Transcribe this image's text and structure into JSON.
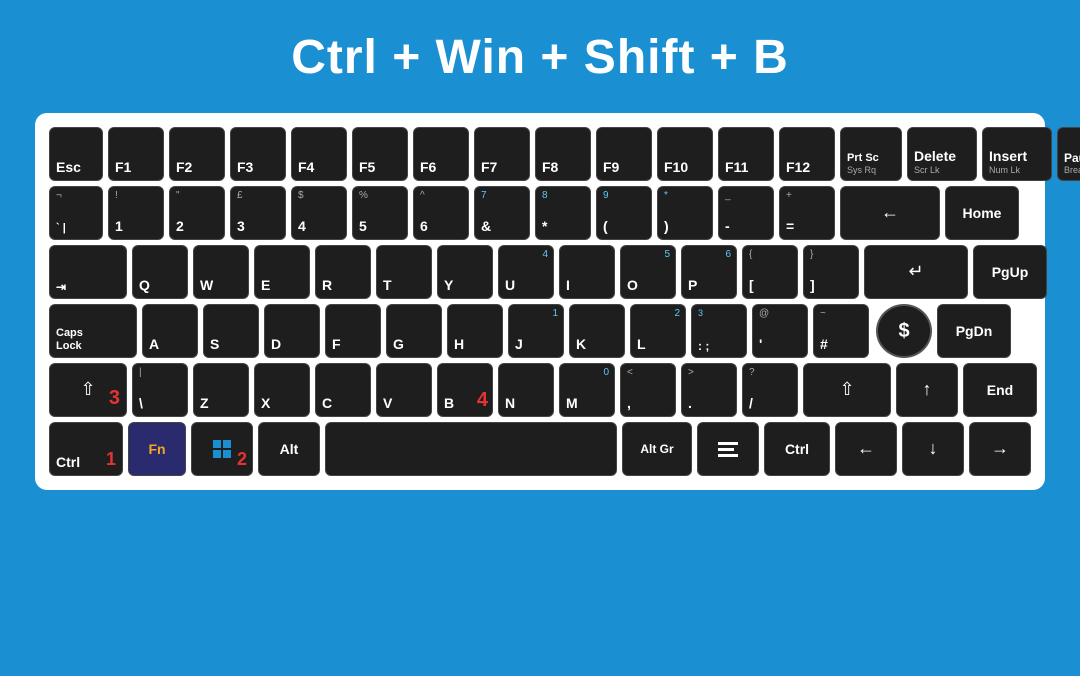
{
  "title": "Ctrl + Win + Shift + B",
  "keyboard": {
    "row1": {
      "keys": [
        "Esc",
        "F1",
        "F2",
        "F3",
        "F4",
        "F5",
        "F6",
        "F7",
        "F8",
        "F9",
        "F10",
        "F11",
        "F12",
        "Prt Sc",
        "Delete",
        "Insert",
        "Pause"
      ]
    }
  }
}
